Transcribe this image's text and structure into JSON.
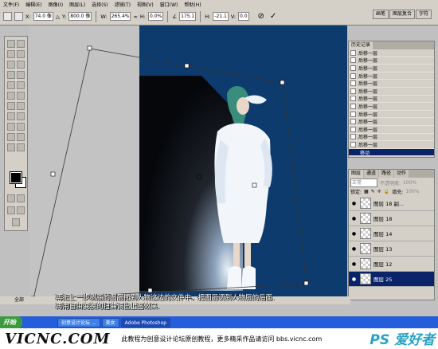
{
  "menu": {
    "items": [
      "文件(F)",
      "编辑(E)",
      "图像(I)",
      "图层(L)",
      "选择(S)",
      "滤镜(T)",
      "视图(V)",
      "窗口(W)",
      "帮助(H)"
    ]
  },
  "options": {
    "x_label": "X:",
    "x_value": "74.0 像",
    "y_label": "Y:",
    "y_value": "800.0 像",
    "w_label": "W:",
    "w_value": "265.4%",
    "h_label": "H:",
    "h_value": "0.0%",
    "angle_value": "175.1",
    "hskew_label": "H:",
    "hskew_value": "-21.1",
    "vskew_label": "V:",
    "vskew_value": "0.0",
    "cancel_icon": "cancel-icon",
    "commit_icon": "commit-icon"
  },
  "well_tabs": [
    "画笔",
    "图层复合",
    "字符"
  ],
  "history": {
    "title": "历史记录",
    "rows": [
      "后移一层",
      "后移一层",
      "后移一层",
      "后移一层",
      "后移一层",
      "后移一层",
      "后移一层",
      "后移一层",
      "后移一层",
      "后移一层",
      "后移一层",
      "后移一层",
      "后移一层"
    ],
    "selected": "移动"
  },
  "layers": {
    "tabs": [
      "图层",
      "通道",
      "路径",
      "动作"
    ],
    "blend_mode": "正常",
    "opacity_label": "不透明度:",
    "opacity_value": "100%",
    "lock_label": "锁定:",
    "fill_label": "填充:",
    "fill_value": "100%",
    "rows": [
      "图层 18 副...",
      "图层 18",
      "图层 14",
      "图层 13",
      "图层 12"
    ],
    "selected": "图层 25"
  },
  "status": {
    "mode": "全部",
    "caption_line1": "再把上一步树脂的图层拖到人物这边的文件中，把图层调到人物层的后面.",
    "caption_line2": "再用自由变换的扭曲调出上图效果."
  },
  "taskbar": {
    "start": "开始",
    "tasks": [
      "创意设计论坛 ...",
      "美女",
      "Adobe Photoshop"
    ]
  },
  "footer": {
    "logo": "VICNC.COM",
    "text": "此教程为创意设计论坛原创教程，更多精采作品请访问 bbs.vicnc.com",
    "watermark": "PS 爱好者"
  },
  "colors": {
    "canvas": "#0d3b6d",
    "selection": "#0a246a",
    "taskbar": "#245edb"
  }
}
